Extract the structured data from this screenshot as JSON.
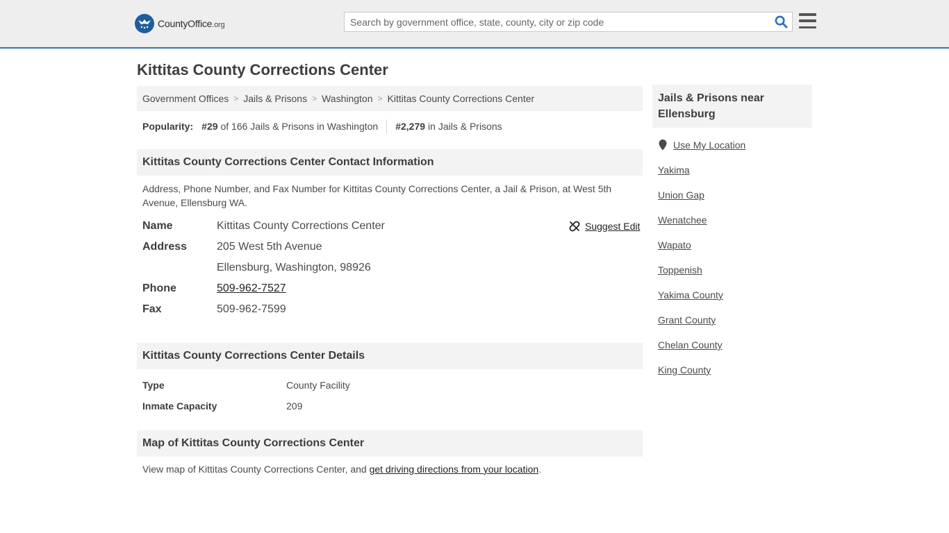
{
  "header": {
    "logo_main": "CountyOffice",
    "logo_tld": ".org",
    "search_placeholder": "Search by government office, state, county, city or zip code"
  },
  "page_title": "Kittitas County Corrections Center",
  "breadcrumb": [
    "Government Offices",
    "Jails & Prisons",
    "Washington",
    "Kittitas County Corrections Center"
  ],
  "popularity": {
    "label": "Popularity:",
    "state_rank": "#29",
    "state_text": "of 166 Jails & Prisons in Washington",
    "national_rank": "#2,279",
    "national_text": "in Jails & Prisons"
  },
  "contact": {
    "heading": "Kittitas County Corrections Center Contact Information",
    "description": "Address, Phone Number, and Fax Number for Kittitas County Corrections Center, a Jail & Prison, at West 5th Avenue, Ellensburg WA.",
    "suggest_edit": "Suggest Edit",
    "name_label": "Name",
    "name_value": "Kittitas County Corrections Center",
    "address_label": "Address",
    "address_line1": "205 West 5th Avenue",
    "address_line2": "Ellensburg, Washington, 98926",
    "phone_label": "Phone",
    "phone_value": "509-962-7527",
    "fax_label": "Fax",
    "fax_value": "509-962-7599"
  },
  "details": {
    "heading": "Kittitas County Corrections Center Details",
    "type_label": "Type",
    "type_value": "County Facility",
    "capacity_label": "Inmate Capacity",
    "capacity_value": "209"
  },
  "map": {
    "heading": "Map of Kittitas County Corrections Center",
    "text_before": "View map of Kittitas County Corrections Center, and ",
    "link": "get driving directions from your location",
    "text_after": "."
  },
  "sidebar": {
    "heading": "Jails & Prisons near Ellensburg",
    "use_location": "Use My Location",
    "links": [
      "Yakima",
      "Union Gap",
      "Wenatchee",
      "Wapato",
      "Toppenish",
      "Yakima County",
      "Grant County",
      "Chelan County",
      "King County"
    ]
  }
}
